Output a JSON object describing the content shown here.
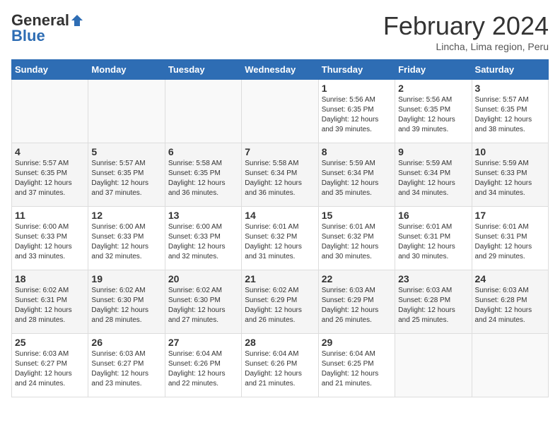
{
  "header": {
    "logo_general": "General",
    "logo_blue": "Blue",
    "month_title": "February 2024",
    "location": "Lincha, Lima region, Peru"
  },
  "weekdays": [
    "Sunday",
    "Monday",
    "Tuesday",
    "Wednesday",
    "Thursday",
    "Friday",
    "Saturday"
  ],
  "weeks": [
    [
      {
        "day": "",
        "sunrise": "",
        "sunset": "",
        "daylight": "",
        "empty": true
      },
      {
        "day": "",
        "sunrise": "",
        "sunset": "",
        "daylight": "",
        "empty": true
      },
      {
        "day": "",
        "sunrise": "",
        "sunset": "",
        "daylight": "",
        "empty": true
      },
      {
        "day": "",
        "sunrise": "",
        "sunset": "",
        "daylight": "",
        "empty": true
      },
      {
        "day": "1",
        "sunrise": "5:56 AM",
        "sunset": "6:35 PM",
        "daylight": "Daylight: 12 hours and 39 minutes."
      },
      {
        "day": "2",
        "sunrise": "5:56 AM",
        "sunset": "6:35 PM",
        "daylight": "Daylight: 12 hours and 39 minutes."
      },
      {
        "day": "3",
        "sunrise": "5:57 AM",
        "sunset": "6:35 PM",
        "daylight": "Daylight: 12 hours and 38 minutes."
      }
    ],
    [
      {
        "day": "4",
        "sunrise": "5:57 AM",
        "sunset": "6:35 PM",
        "daylight": "Daylight: 12 hours and 37 minutes."
      },
      {
        "day": "5",
        "sunrise": "5:57 AM",
        "sunset": "6:35 PM",
        "daylight": "Daylight: 12 hours and 37 minutes."
      },
      {
        "day": "6",
        "sunrise": "5:58 AM",
        "sunset": "6:35 PM",
        "daylight": "Daylight: 12 hours and 36 minutes."
      },
      {
        "day": "7",
        "sunrise": "5:58 AM",
        "sunset": "6:34 PM",
        "daylight": "Daylight: 12 hours and 36 minutes."
      },
      {
        "day": "8",
        "sunrise": "5:59 AM",
        "sunset": "6:34 PM",
        "daylight": "Daylight: 12 hours and 35 minutes."
      },
      {
        "day": "9",
        "sunrise": "5:59 AM",
        "sunset": "6:34 PM",
        "daylight": "Daylight: 12 hours and 34 minutes."
      },
      {
        "day": "10",
        "sunrise": "5:59 AM",
        "sunset": "6:33 PM",
        "daylight": "Daylight: 12 hours and 34 minutes."
      }
    ],
    [
      {
        "day": "11",
        "sunrise": "6:00 AM",
        "sunset": "6:33 PM",
        "daylight": "Daylight: 12 hours and 33 minutes."
      },
      {
        "day": "12",
        "sunrise": "6:00 AM",
        "sunset": "6:33 PM",
        "daylight": "Daylight: 12 hours and 32 minutes."
      },
      {
        "day": "13",
        "sunrise": "6:00 AM",
        "sunset": "6:33 PM",
        "daylight": "Daylight: 12 hours and 32 minutes."
      },
      {
        "day": "14",
        "sunrise": "6:01 AM",
        "sunset": "6:32 PM",
        "daylight": "Daylight: 12 hours and 31 minutes."
      },
      {
        "day": "15",
        "sunrise": "6:01 AM",
        "sunset": "6:32 PM",
        "daylight": "Daylight: 12 hours and 30 minutes."
      },
      {
        "day": "16",
        "sunrise": "6:01 AM",
        "sunset": "6:31 PM",
        "daylight": "Daylight: 12 hours and 30 minutes."
      },
      {
        "day": "17",
        "sunrise": "6:01 AM",
        "sunset": "6:31 PM",
        "daylight": "Daylight: 12 hours and 29 minutes."
      }
    ],
    [
      {
        "day": "18",
        "sunrise": "6:02 AM",
        "sunset": "6:31 PM",
        "daylight": "Daylight: 12 hours and 28 minutes."
      },
      {
        "day": "19",
        "sunrise": "6:02 AM",
        "sunset": "6:30 PM",
        "daylight": "Daylight: 12 hours and 28 minutes."
      },
      {
        "day": "20",
        "sunrise": "6:02 AM",
        "sunset": "6:30 PM",
        "daylight": "Daylight: 12 hours and 27 minutes."
      },
      {
        "day": "21",
        "sunrise": "6:02 AM",
        "sunset": "6:29 PM",
        "daylight": "Daylight: 12 hours and 26 minutes."
      },
      {
        "day": "22",
        "sunrise": "6:03 AM",
        "sunset": "6:29 PM",
        "daylight": "Daylight: 12 hours and 26 minutes."
      },
      {
        "day": "23",
        "sunrise": "6:03 AM",
        "sunset": "6:28 PM",
        "daylight": "Daylight: 12 hours and 25 minutes."
      },
      {
        "day": "24",
        "sunrise": "6:03 AM",
        "sunset": "6:28 PM",
        "daylight": "Daylight: 12 hours and 24 minutes."
      }
    ],
    [
      {
        "day": "25",
        "sunrise": "6:03 AM",
        "sunset": "6:27 PM",
        "daylight": "Daylight: 12 hours and 24 minutes."
      },
      {
        "day": "26",
        "sunrise": "6:03 AM",
        "sunset": "6:27 PM",
        "daylight": "Daylight: 12 hours and 23 minutes."
      },
      {
        "day": "27",
        "sunrise": "6:04 AM",
        "sunset": "6:26 PM",
        "daylight": "Daylight: 12 hours and 22 minutes."
      },
      {
        "day": "28",
        "sunrise": "6:04 AM",
        "sunset": "6:26 PM",
        "daylight": "Daylight: 12 hours and 21 minutes."
      },
      {
        "day": "29",
        "sunrise": "6:04 AM",
        "sunset": "6:25 PM",
        "daylight": "Daylight: 12 hours and 21 minutes."
      },
      {
        "day": "",
        "sunrise": "",
        "sunset": "",
        "daylight": "",
        "empty": true
      },
      {
        "day": "",
        "sunrise": "",
        "sunset": "",
        "daylight": "",
        "empty": true
      }
    ]
  ]
}
